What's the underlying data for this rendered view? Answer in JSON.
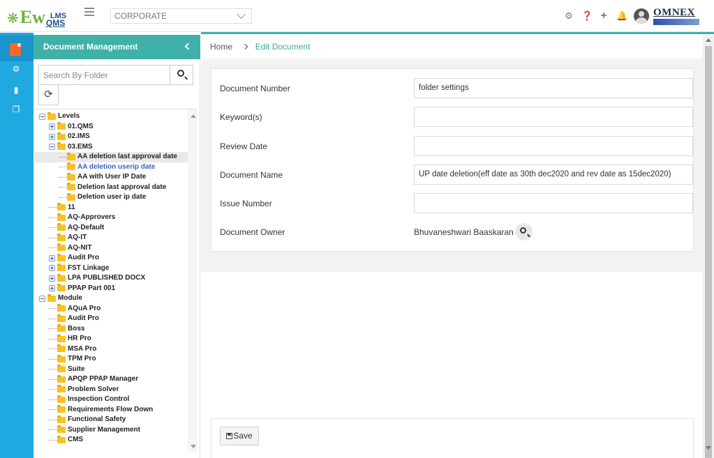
{
  "header": {
    "logo_main": "Ew",
    "logo_lms": "LMS",
    "logo_qms": "QMS",
    "org_select": "CORPORATE",
    "brand": "OMNEX",
    "icons": [
      "gear-icon",
      "help-icon",
      "plus-icon",
      "bell-icon",
      "user-avatar"
    ]
  },
  "nav_strip": {
    "items": [
      "document-icon",
      "settings-icon",
      "book-icon",
      "copy-icon"
    ]
  },
  "panel": {
    "title": "Document Management",
    "search_placeholder": "Search By Folder"
  },
  "tree": [
    {
      "label": "Levels",
      "level": 0,
      "toggle": "minus"
    },
    {
      "label": "01.QMS",
      "level": 1,
      "toggle": "plus"
    },
    {
      "label": "02.IMS",
      "level": 1,
      "toggle": "plus"
    },
    {
      "label": "03.EMS",
      "level": 1,
      "toggle": "minus"
    },
    {
      "label": "AA deletion last approval date",
      "level": 2,
      "state": "selected"
    },
    {
      "label": "AA deletion userip date",
      "level": 2,
      "state": "highlight"
    },
    {
      "label": "AA with User IP Date",
      "level": 2
    },
    {
      "label": "Deletion last approval date",
      "level": 2
    },
    {
      "label": "Deletion user ip date",
      "level": 2
    },
    {
      "label": "11",
      "level": 1
    },
    {
      "label": "AQ-Approvers",
      "level": 1
    },
    {
      "label": "AQ-Default",
      "level": 1
    },
    {
      "label": "AQ-IT",
      "level": 1
    },
    {
      "label": "AQ-NIT",
      "level": 1
    },
    {
      "label": "Audit Pro",
      "level": 1,
      "toggle": "plus"
    },
    {
      "label": "FST Linkage",
      "level": 1,
      "toggle": "plus"
    },
    {
      "label": "LPA PUBLISHED DOCX",
      "level": 1,
      "toggle": "plus"
    },
    {
      "label": "PPAP Part 001",
      "level": 1,
      "toggle": "plus"
    },
    {
      "label": "Module",
      "level": 0,
      "toggle": "minus"
    },
    {
      "label": "AQuA Pro",
      "level": 1
    },
    {
      "label": "Audit Pro",
      "level": 1
    },
    {
      "label": "Boss",
      "level": 1
    },
    {
      "label": "HR Pro",
      "level": 1
    },
    {
      "label": "MSA Pro",
      "level": 1
    },
    {
      "label": "TPM Pro",
      "level": 1
    },
    {
      "label": "Suite",
      "level": 1
    },
    {
      "label": "APQP PPAP Manager",
      "level": 1
    },
    {
      "label": "Problem Solver",
      "level": 1
    },
    {
      "label": "Inspection Control",
      "level": 1
    },
    {
      "label": "Requirements Flow Down",
      "level": 1
    },
    {
      "label": "Functional Safety",
      "level": 1
    },
    {
      "label": "Supplier Management",
      "level": 1
    },
    {
      "label": "CMS",
      "level": 1
    }
  ],
  "breadcrumb": {
    "home": "Home",
    "current": "Edit Document"
  },
  "form": {
    "document_number_label": "Document Number",
    "document_number_value": "folder settings",
    "keywords_label": "Keyword(s)",
    "keywords_value": "",
    "review_date_label": "Review Date",
    "review_date_value": "",
    "document_name_label": "Document Name",
    "document_name_value": "UP date deletion(eff date as 30th dec2020 and rev date as 15dec2020)",
    "issue_number_label": "Issue Number",
    "issue_number_value": "",
    "document_owner_label": "Document Owner",
    "document_owner_value": "Bhuvaneshwari Baaskaran"
  },
  "actions": {
    "save_label": "Save"
  },
  "colors": {
    "accent_teal": "#3fb1a8",
    "nav_blue": "#20a8e1",
    "folder_yellow": "#f7c223"
  }
}
